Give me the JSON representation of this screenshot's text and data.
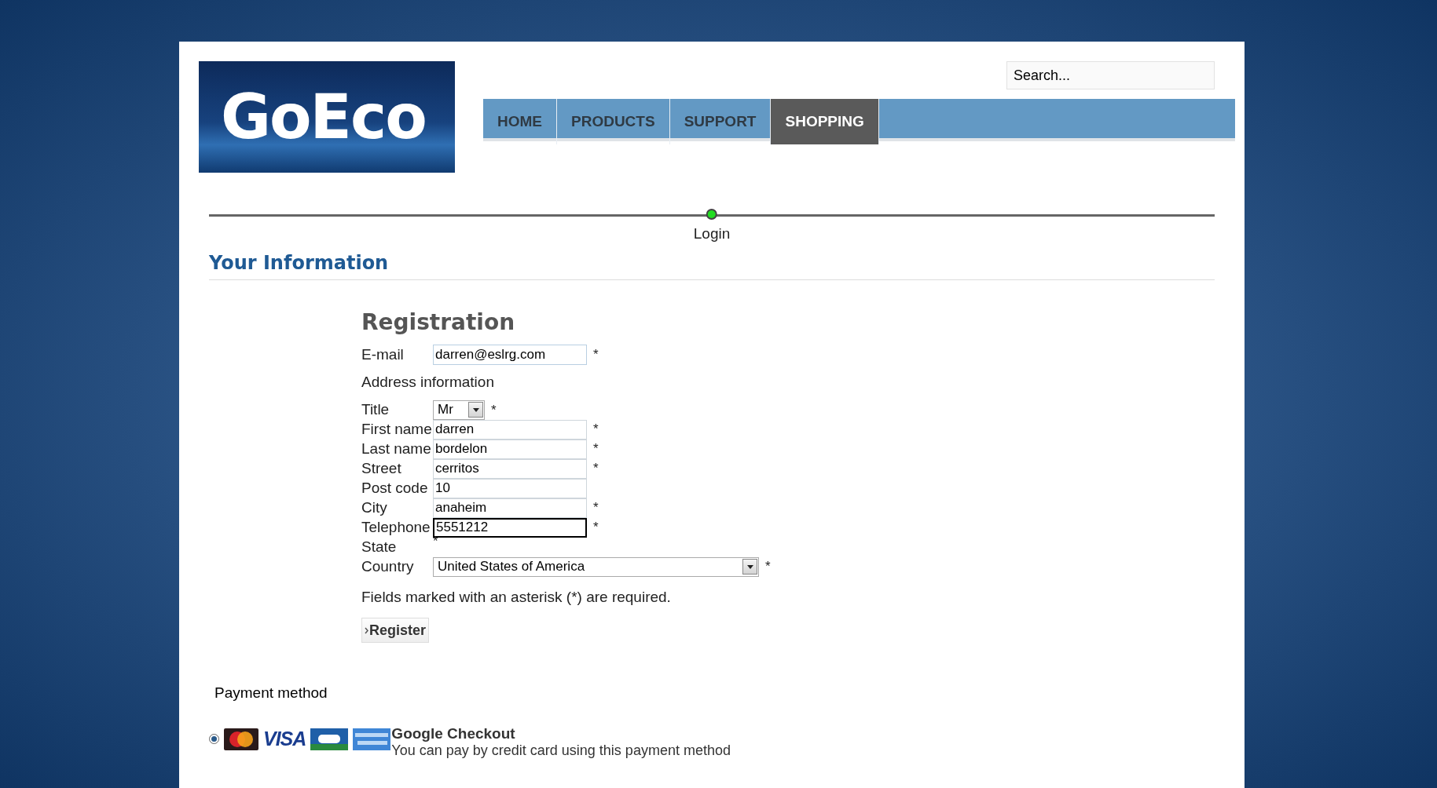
{
  "logo": {
    "text": "GoEco"
  },
  "search": {
    "placeholder": "Search..."
  },
  "nav": [
    {
      "label": "HOME",
      "selected": false
    },
    {
      "label": "PRODUCTS",
      "selected": false
    },
    {
      "label": "SUPPORT",
      "selected": false
    },
    {
      "label": "SHOPPING",
      "selected": true
    }
  ],
  "steps": [
    {
      "label": "Login",
      "selected": true
    }
  ],
  "section_title": "Your Information",
  "registration": {
    "title": "Registration",
    "email": {
      "label": "E-mail",
      "value": "darren@eslrg.com",
      "marker": "*"
    },
    "address_heading": "Address information",
    "fields": [
      {
        "label": "Title",
        "kind": "small-select",
        "value": "Mr",
        "marker": "*",
        "focused": false
      },
      {
        "label": "First name",
        "kind": "text",
        "value": "darren",
        "marker": "*",
        "focused": false
      },
      {
        "label": "Last name",
        "kind": "text",
        "value": "bordelon",
        "marker": "*",
        "focused": false
      },
      {
        "label": "Street",
        "kind": "text",
        "value": "cerritos",
        "marker": "*",
        "focused": false
      },
      {
        "label": "Post code",
        "kind": "text",
        "value": "10",
        "focused": false
      },
      {
        "label": "City",
        "kind": "text",
        "value": "anaheim",
        "marker": "*",
        "focused": false
      },
      {
        "label": "Telephone",
        "kind": "text",
        "value": "5551212",
        "marker": "*",
        "focused": true
      },
      {
        "label": "State",
        "kind": "empty",
        "marker": "*"
      },
      {
        "label": "Country",
        "kind": "wide-select",
        "value": "United States of America",
        "marker": "*",
        "focused": false
      }
    ],
    "required_note": "Fields marked with an asterisk (*) are required.",
    "button": "Register"
  },
  "payment": {
    "heading": "Payment method",
    "methods": [
      {
        "selected": true,
        "cards": [
          {
            "kind": "mastercard"
          },
          {
            "kind": "visa",
            "label": "VISA"
          },
          {
            "kind": "cb"
          },
          {
            "kind": "amex"
          }
        ],
        "name": "Google Checkout",
        "description": "You can pay by credit card using this payment method"
      }
    ]
  }
}
